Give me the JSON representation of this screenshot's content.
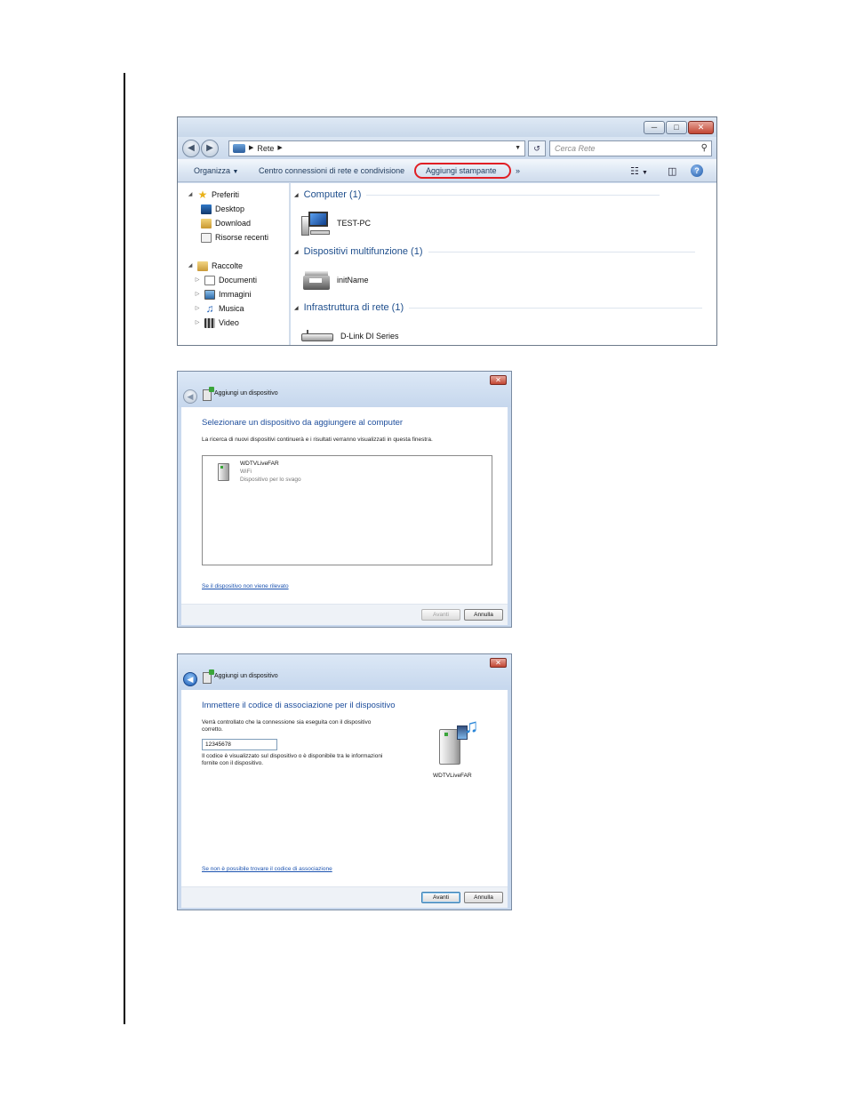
{
  "explorer": {
    "breadcrumb": [
      "Rete"
    ],
    "search_placeholder": "Cerca Rete",
    "commands": {
      "organize": "Organizza",
      "network_center": "Centro connessioni di rete e condivisione",
      "add_printer": "Aggiungi stampante",
      "more": "»"
    },
    "nav": {
      "favorites": "Preferiti",
      "desktop": "Desktop",
      "download": "Download",
      "recent": "Risorse recenti",
      "libraries": "Raccolte",
      "documents": "Documenti",
      "images": "Immagini",
      "music": "Musica",
      "video": "Video"
    },
    "groups": [
      {
        "label": "Computer (1)",
        "item": "TEST-PC"
      },
      {
        "label": "Dispositivi multifunzione (1)",
        "item": "initName"
      },
      {
        "label": "Infrastruttura di rete (1)",
        "item": "D-Link DI Series"
      }
    ],
    "highlight_color": "#e01f25"
  },
  "dialog1": {
    "caption": "Aggiungi un dispositivo",
    "heading": "Selezionare un dispositivo da aggiungere al computer",
    "description": "La ricerca di nuovi dispositivi continuerà e i risultati verranno visualizzati in questa finestra.",
    "device": {
      "name": "WDTVLiveFAR",
      "type": "WiFi",
      "category": "Dispositivo per lo svago"
    },
    "link": "Se il dispositivo non viene rilevato",
    "next": "Avanti",
    "cancel": "Annulla"
  },
  "dialog2": {
    "caption": "Aggiungi un dispositivo",
    "heading": "Immettere il codice di associazione per il dispositivo",
    "text1_line1": "Verrà controllato che la connessione sia eseguita con il dispositivo",
    "text1_line2": "corretto.",
    "code": "12345678",
    "text2_line1": "Il codice è visualizzato sul dispositivo o è disponibile tra le informazioni",
    "text2_line2": "fornite con il dispositivo.",
    "device_label": "WDTVLiveFAR",
    "link": "Se non è possibile trovare il codice di associazione",
    "next": "Avanti",
    "cancel": "Annulla"
  }
}
